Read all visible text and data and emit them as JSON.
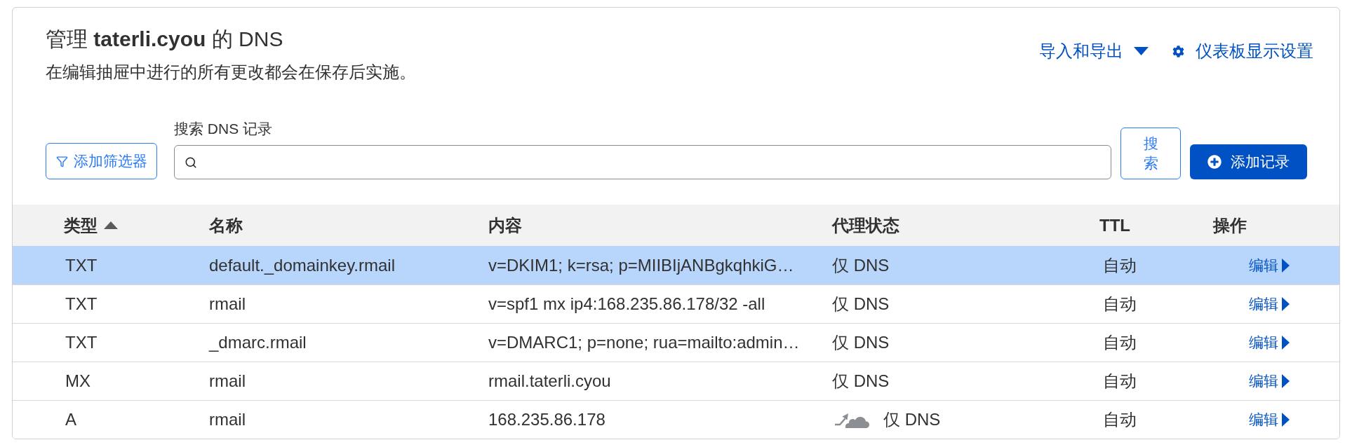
{
  "header": {
    "title": "管理 **taterli.cyou** 的 DNS",
    "subtitle": "在编辑抽屉中进行的所有更改都会在保存后实施。",
    "links": [
      {
        "label": "导入和导出",
        "kind": "dropdown"
      },
      {
        "label": "仪表板显示设置",
        "kind": "settings"
      }
    ]
  },
  "toolbar": {
    "filter_button": "添加筛选器",
    "search": {
      "label": "搜索 DNS 记录"
    },
    "search_button": "搜索",
    "add_button": "添加记录"
  },
  "table": {
    "columns": [
      {
        "label": "类型",
        "sorted": true
      },
      {
        "label": "名称",
        "sorted": false
      },
      {
        "label": "内容",
        "sorted": false
      },
      {
        "label": "代理状态",
        "sorted": false
      },
      {
        "label": "TTL",
        "sorted": false
      },
      {
        "label": "操作",
        "sorted": false
      }
    ],
    "rows": [
      {
        "type": "TXT",
        "name": "default._domainkey.rmail",
        "content": "v=DKIM1; k=rsa; p=MIIBIjANBgkqhkiG…",
        "proxy_status": "仅 DNS",
        "proxiable": false,
        "ttl": "自动",
        "action": "编辑",
        "selected": true
      },
      {
        "type": "TXT",
        "name": "rmail",
        "content": "v=spf1 mx ip4:168.235.86.178/32 -all",
        "proxy_status": "仅 DNS",
        "proxiable": false,
        "ttl": "自动",
        "action": "编辑",
        "selected": false
      },
      {
        "type": "TXT",
        "name": "_dmarc.rmail",
        "content": "v=DMARC1; p=none; rua=mailto:admin…",
        "proxy_status": "仅 DNS",
        "proxiable": false,
        "ttl": "自动",
        "action": "编辑",
        "selected": false
      },
      {
        "type": "MX",
        "name": "rmail",
        "content": "rmail.taterli.cyou",
        "proxy_status": "仅 DNS",
        "proxiable": false,
        "ttl": "自动",
        "action": "编辑",
        "selected": false
      },
      {
        "type": "A",
        "name": "rmail",
        "content": "168.235.86.178",
        "proxy_status": "仅 DNS",
        "proxiable": true,
        "ttl": "自动",
        "action": "编辑",
        "selected": false
      }
    ]
  }
}
